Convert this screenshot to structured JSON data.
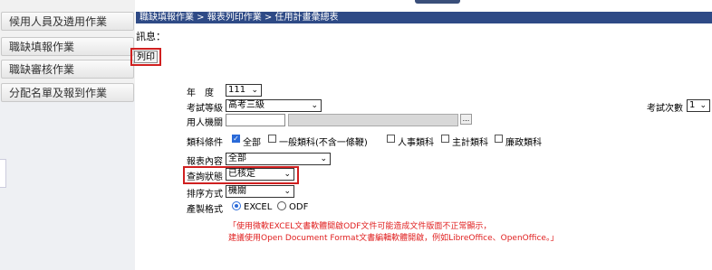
{
  "sidebar": {
    "items": [
      {
        "label": "候用人員及遴用作業"
      },
      {
        "label": "職缺填報作業"
      },
      {
        "label": "職缺審核作業"
      },
      {
        "label": "分配名單及報到作業"
      }
    ]
  },
  "breadcrumb": "職缺填報作業 > 報表列印作業 > 任用計畫彙總表",
  "message_label": "訊息：",
  "print_button": "列印",
  "form": {
    "year": {
      "label": "年　度",
      "value": "111"
    },
    "exam_level": {
      "label": "考試等級",
      "value": "高考三級"
    },
    "exam_count": {
      "label": "考試次數",
      "value": "1"
    },
    "agency": {
      "label": "用人機關",
      "button": "..."
    },
    "category": {
      "label": "類科條件",
      "options": [
        {
          "label": "全部",
          "checked": true
        },
        {
          "label": "一般類科(不含一條鞭)",
          "checked": false
        },
        {
          "label": "人事類科",
          "checked": false
        },
        {
          "label": "主計類科",
          "checked": false
        },
        {
          "label": "廉政類科",
          "checked": false
        }
      ]
    },
    "report_content": {
      "label": "報表內容",
      "value": "全部"
    },
    "query_status": {
      "label": "查詢狀態",
      "value": "已核定"
    },
    "sort_method": {
      "label": "排序方式",
      "value": "機關"
    },
    "output_format": {
      "label": "產製格式",
      "options": [
        {
          "label": "EXCEL",
          "selected": true
        },
        {
          "label": "ODF",
          "selected": false
        }
      ]
    },
    "note_line1": "「使用微軟EXCEL文書軟體開啟ODF文件可能造成文件版面不正常顯示，",
    "note_line2": "建議使用Open Document Format文書編輯軟體開啟，例如LibreOffice、OpenOffice。」"
  },
  "colors": {
    "header_bg": "#2e4a86",
    "highlight": "#d02020",
    "note_text": "#e02020"
  }
}
